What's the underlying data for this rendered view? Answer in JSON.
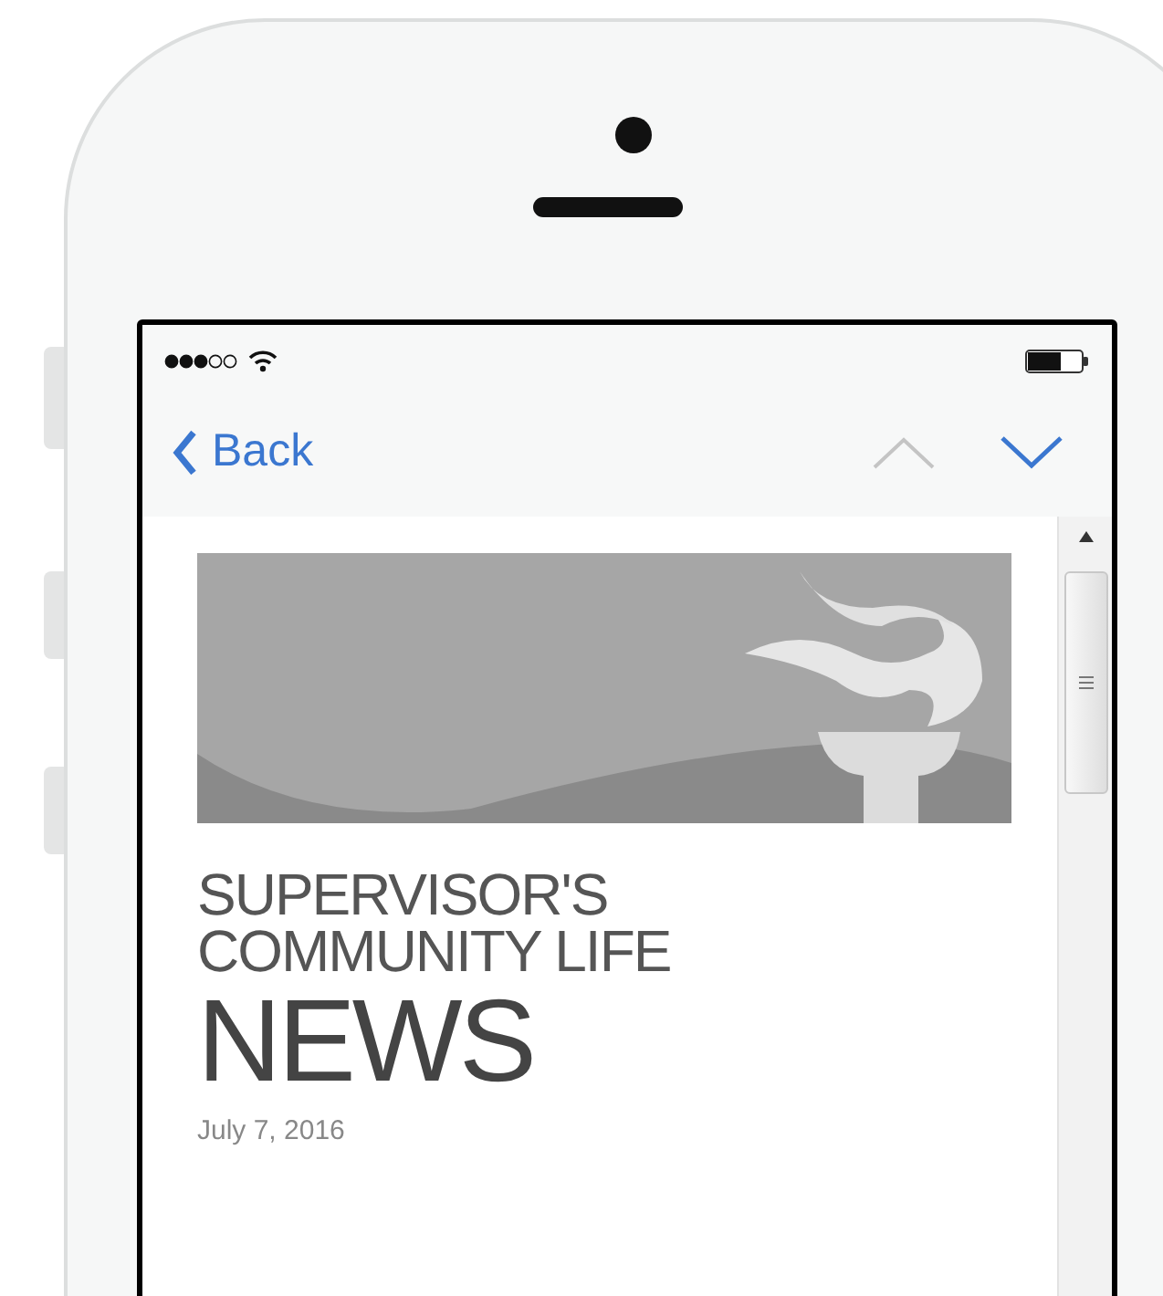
{
  "nav": {
    "back_label": "Back",
    "previous_enabled": false,
    "next_enabled": true
  },
  "article": {
    "title_lines": [
      "SUPERVISOR'S",
      "COMMUNITY LIFE"
    ],
    "title_emphasis": "NEWS",
    "date": "July 7, 2016"
  }
}
